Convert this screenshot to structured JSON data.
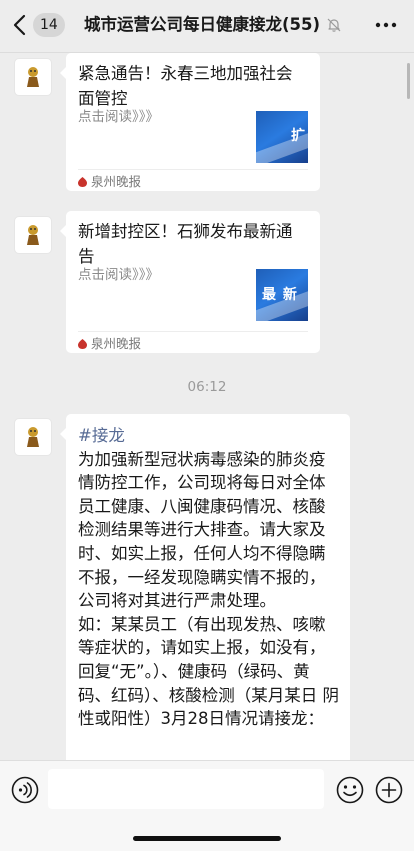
{
  "header": {
    "unread_count": "14",
    "title": "城市运营公司每日健康接龙(55)"
  },
  "messages": [
    {
      "type": "article",
      "title": "紧急通告！永春三地加强社会面管控",
      "desc": "点击阅读》》》",
      "thumb_text": "扩",
      "source": "泉州晚报"
    },
    {
      "type": "article",
      "title": "新增封控区！石狮发布最新通告",
      "desc": "点击阅读》》》",
      "thumb_text": "最 新",
      "source": "泉州晚报"
    },
    {
      "type": "timestamp",
      "text": "06:12"
    },
    {
      "type": "text",
      "hashtag": "#接龙",
      "body": "为加强新型冠状病毒感染的肺炎疫情防控工作，公司现将每日对全体员工健康、八闽健康码情况、核酸检测结果等进行大排查。请大家及时、如实上报，任何人均不得隐瞒不报，一经发现隐瞒实情不报的，公司将对其进行严肃处理。",
      "body2": "如：某某员工（有出现发热、咳嗽等症状的，请如实上报，如没有，回复“无”。）、健康码（绿码、黄码、红码）、核酸检测（某月某日 阴性或阳性）3月28日情况请接龙："
    }
  ],
  "input": {
    "value": ""
  },
  "icons": {
    "back": "chevron-left-icon",
    "mute": "bell-off-icon",
    "more": "more-dots-icon",
    "voice": "voice-icon",
    "emoji": "emoji-icon",
    "plus": "plus-circle-icon"
  },
  "colors": {
    "background": "#ededed",
    "bubble": "#ffffff",
    "hashtag": "#576b95",
    "source_icon": "#c8332c",
    "thumbnail": "#2a7be0"
  }
}
